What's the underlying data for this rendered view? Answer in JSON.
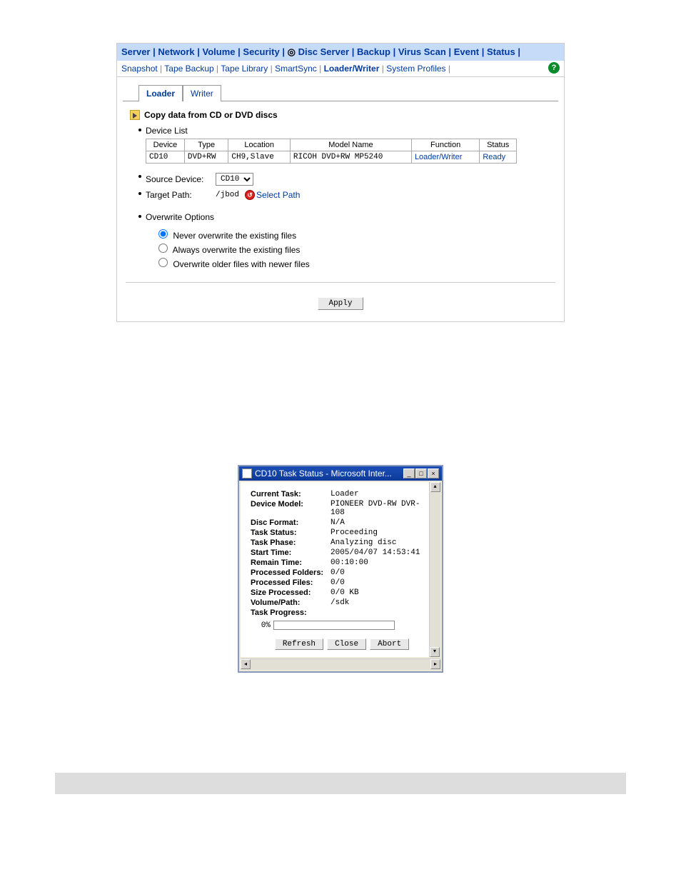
{
  "topnav": [
    "Server",
    "Network",
    "Volume",
    "Security",
    "Disc Server",
    "Backup",
    "Virus Scan",
    "Event",
    "Status"
  ],
  "topnav_active": "Backup",
  "subnav": [
    "Snapshot",
    "Tape Backup",
    "Tape Library",
    "SmartSync",
    "Loader/Writer",
    "System Profiles"
  ],
  "subnav_active": "Loader/Writer",
  "tabs": {
    "loader": "Loader",
    "writer": "Writer"
  },
  "section_title": "Copy data from CD or DVD discs",
  "device_list_label": "Device List",
  "headers": {
    "device": "Device",
    "type": "Type",
    "location": "Location",
    "model": "Model Name",
    "function": "Function",
    "status": "Status"
  },
  "rows": [
    {
      "device": "CD10",
      "type": "DVD+RW",
      "location": "CH9,Slave",
      "model": "RICOH DVD+RW MP5240",
      "function": "Loader/Writer",
      "status": "Ready"
    }
  ],
  "source_device_label": "Source Device:",
  "source_device_value": "CD10",
  "target_path_label": "Target Path:",
  "target_path_value": "/jbod",
  "select_path_label": "Select Path",
  "overwrite_options_label": "Overwrite Options",
  "ow": {
    "never": "Never overwrite the existing files",
    "always": "Always overwrite the existing files",
    "older": "Overwrite older files with newer files"
  },
  "apply_label": "Apply",
  "popup": {
    "title": "CD10 Task Status - Microsoft Inter...",
    "rows": {
      "current_task": {
        "label": "Current Task:",
        "value": "Loader"
      },
      "device_model": {
        "label": "Device Model:",
        "value": "PIONEER DVD-RW DVR-108"
      },
      "disc_format": {
        "label": "Disc Format:",
        "value": "N/A"
      },
      "task_status": {
        "label": "Task Status:",
        "value": "Proceeding"
      },
      "task_phase": {
        "label": "Task Phase:",
        "value": "Analyzing disc"
      },
      "start_time": {
        "label": "Start Time:",
        "value": "2005/04/07 14:53:41"
      },
      "remain_time": {
        "label": "Remain Time:",
        "value": "00:10:00"
      },
      "processed_folders": {
        "label": "Processed Folders:",
        "value": "0/0"
      },
      "processed_files": {
        "label": "Processed Files:",
        "value": "0/0"
      },
      "size_processed": {
        "label": "Size Processed:",
        "value": "0/0 KB"
      },
      "volume_path": {
        "label": "Volume/Path:",
        "value": "/sdk"
      },
      "task_progress": {
        "label": "Task Progress:",
        "value": ""
      }
    },
    "progress_pct": "0%",
    "buttons": {
      "refresh": "Refresh",
      "close": "Close",
      "abort": "Abort"
    }
  }
}
